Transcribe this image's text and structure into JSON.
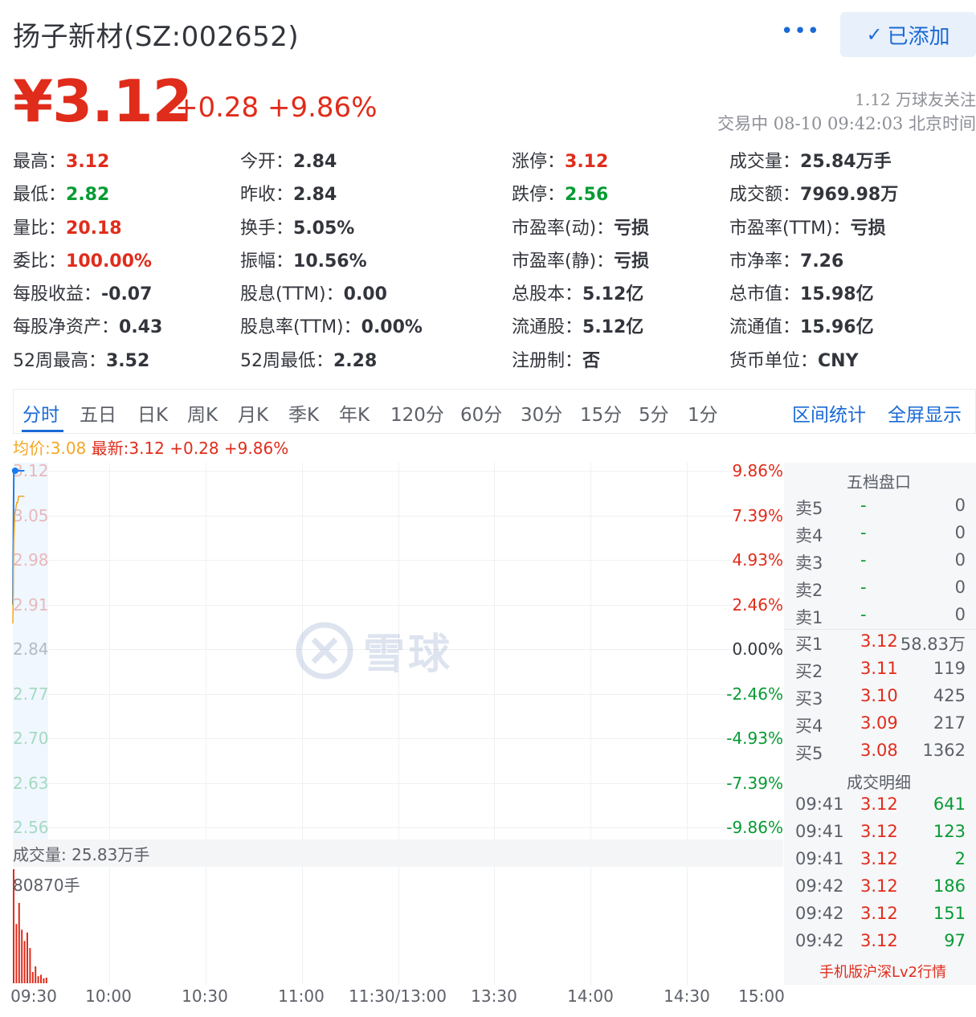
{
  "header": {
    "title": "扬子新材(SZ:002652)",
    "more": "•••",
    "added_label": "已添加",
    "price": "¥3.12",
    "change": "+0.28 +9.86%",
    "followers": "1.12 万球友关注",
    "trade_time": "交易中 08-10 09:42:03 北京时间"
  },
  "stats": [
    {
      "label": "最高：",
      "value": "3.12",
      "color": "#e02c1b"
    },
    {
      "label": "今开：",
      "value": "2.84",
      "color": "#33353c"
    },
    {
      "label": "涨停：",
      "value": "3.12",
      "color": "#e02c1b"
    },
    {
      "label": "成交量：",
      "value": "25.84万手",
      "color": "#33353c"
    },
    {
      "label": "最低：",
      "value": "2.82",
      "color": "#079b33"
    },
    {
      "label": "昨收：",
      "value": "2.84",
      "color": "#33353c"
    },
    {
      "label": "跌停：",
      "value": "2.56",
      "color": "#079b33"
    },
    {
      "label": "成交额：",
      "value": "7969.98万",
      "color": "#33353c"
    },
    {
      "label": "量比：",
      "value": "20.18",
      "color": "#e02c1b"
    },
    {
      "label": "换手：",
      "value": "5.05%",
      "color": "#33353c"
    },
    {
      "label": "市盈率(动)：",
      "value": "亏损",
      "color": "#33353c"
    },
    {
      "label": "市盈率(TTM)：",
      "value": "亏损",
      "color": "#33353c"
    },
    {
      "label": "委比：",
      "value": "100.00%",
      "color": "#e02c1b"
    },
    {
      "label": "振幅：",
      "value": "10.56%",
      "color": "#33353c"
    },
    {
      "label": "市盈率(静)：",
      "value": "亏损",
      "color": "#33353c"
    },
    {
      "label": "市净率：",
      "value": "7.26",
      "color": "#33353c"
    },
    {
      "label": "每股收益：",
      "value": "-0.07",
      "color": "#33353c"
    },
    {
      "label": "股息(TTM)：",
      "value": "0.00",
      "color": "#33353c"
    },
    {
      "label": "总股本：",
      "value": "5.12亿",
      "color": "#33353c"
    },
    {
      "label": "总市值：",
      "value": "15.98亿",
      "color": "#33353c"
    },
    {
      "label": "每股净资产：",
      "value": "0.43",
      "color": "#33353c"
    },
    {
      "label": "股息率(TTM)：",
      "value": "0.00%",
      "color": "#33353c"
    },
    {
      "label": "流通股：",
      "value": "5.12亿",
      "color": "#33353c"
    },
    {
      "label": "流通值：",
      "value": "15.96亿",
      "color": "#33353c"
    },
    {
      "label": "52周最高：",
      "value": "3.52",
      "color": "#33353c"
    },
    {
      "label": "52周最低：",
      "value": "2.28",
      "color": "#33353c"
    },
    {
      "label": "注册制：",
      "value": "否",
      "color": "#33353c"
    },
    {
      "label": "货币单位：",
      "value": "CNY",
      "color": "#33353c"
    }
  ],
  "tabs": [
    "分时",
    "五日",
    "日K",
    "周K",
    "月K",
    "季K",
    "年K",
    "120分",
    "60分",
    "30分",
    "15分",
    "5分",
    "1分"
  ],
  "tab_links": [
    "区间统计",
    "全屏显示"
  ],
  "legend": {
    "avg": "均价:3.08",
    "last": "最新:3.12 +0.28 +9.86%"
  },
  "chart_data": {
    "type": "line",
    "y_price_ticks": [
      "3.12",
      "3.05",
      "2.98",
      "2.91",
      "2.84",
      "2.77",
      "2.70",
      "2.63",
      "2.56"
    ],
    "y_pct_ticks": [
      "9.86%",
      "7.39%",
      "4.93%",
      "2.46%",
      "0.00%",
      "-2.46%",
      "-4.93%",
      "-7.39%",
      "-9.86%"
    ],
    "ylim": [
      2.56,
      3.12
    ],
    "x_ticks": [
      "09:30",
      "10:00",
      "10:30",
      "11:00",
      "11:30/13:00",
      "13:30",
      "14:00",
      "14:30",
      "15:00"
    ],
    "series": [
      {
        "name": "最新",
        "color": "#1a7cf0",
        "x_min": [
          0,
          1,
          2,
          3,
          4,
          5,
          6,
          7,
          8,
          9,
          10,
          11,
          12
        ],
        "values": [
          2.91,
          3.12,
          3.12,
          3.12,
          3.12,
          3.12,
          3.12,
          3.12,
          3.12,
          3.12,
          3.12,
          3.12,
          3.12
        ]
      },
      {
        "name": "均价",
        "color": "#f5a623",
        "x_min": [
          0,
          1,
          2,
          3,
          4,
          5,
          6,
          7,
          8,
          9,
          10,
          11,
          12
        ],
        "values": [
          2.88,
          3.01,
          3.05,
          3.06,
          3.07,
          3.07,
          3.08,
          3.08,
          3.08,
          3.08,
          3.08,
          3.08,
          3.08
        ]
      }
    ],
    "volume_label": "成交量: 25.83万手",
    "volume_max_label": "80870手",
    "volume_max": 80870,
    "volume": [
      80870,
      42000,
      57000,
      38000,
      30000,
      36000,
      25000,
      8000,
      12000,
      5000,
      6000,
      3500,
      4000
    ]
  },
  "orderbook": {
    "title": "五档盘口",
    "asks": [
      {
        "label": "卖5",
        "price": "-",
        "vol": "0"
      },
      {
        "label": "卖4",
        "price": "-",
        "vol": "0"
      },
      {
        "label": "卖3",
        "price": "-",
        "vol": "0"
      },
      {
        "label": "卖2",
        "price": "-",
        "vol": "0"
      },
      {
        "label": "卖1",
        "price": "-",
        "vol": "0"
      }
    ],
    "bids": [
      {
        "label": "买1",
        "price": "3.12",
        "vol": "58.83万"
      },
      {
        "label": "买2",
        "price": "3.11",
        "vol": "119"
      },
      {
        "label": "买3",
        "price": "3.10",
        "vol": "425"
      },
      {
        "label": "买4",
        "price": "3.09",
        "vol": "217"
      },
      {
        "label": "买5",
        "price": "3.08",
        "vol": "1362"
      }
    ]
  },
  "trades": {
    "title": "成交明细",
    "rows": [
      {
        "time": "09:41",
        "price": "3.12",
        "vol": "641"
      },
      {
        "time": "09:41",
        "price": "3.12",
        "vol": "123"
      },
      {
        "time": "09:41",
        "price": "3.12",
        "vol": "2"
      },
      {
        "time": "09:42",
        "price": "3.12",
        "vol": "186"
      },
      {
        "time": "09:42",
        "price": "3.12",
        "vol": "151"
      },
      {
        "time": "09:42",
        "price": "3.12",
        "vol": "97"
      }
    ],
    "lv2_link": "手机版沪深Lv2行情"
  },
  "watermark": "雪球",
  "colors": {
    "up": "#e02c1b",
    "down": "#079b33",
    "accent": "#1a6ad6",
    "avg": "#f5a623",
    "price_line": "#1a7cf0"
  }
}
